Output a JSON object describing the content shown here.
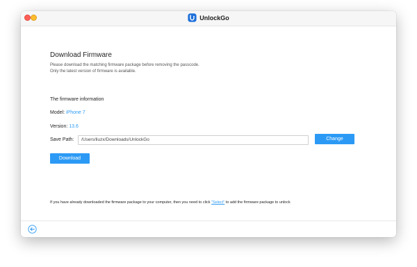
{
  "window": {
    "app_title": "UnlockGo"
  },
  "main": {
    "heading": "Download Firmware",
    "description_line1": "Please download the matching firmware package before removing the passcode.",
    "description_line2": "Only the latest version of firmware is available.",
    "section_title": "The firmware information",
    "model_label": "Model:",
    "model_value": "iPhone 7",
    "version_label": "Version:",
    "version_value": "13.6",
    "save_path_label": "Save Path:",
    "save_path_value": "/Users/liuzx/Downloads/UnlockGo",
    "change_button": "Change",
    "download_button": "Download",
    "footnote_prefix": "If you have already downloaded the firmware package to your computer, then you need to click ",
    "footnote_link": "\"Select\"",
    "footnote_suffix": " to add the firmware package to unlock"
  },
  "colors": {
    "accent": "#2c9af5",
    "close_light": "#fd5f57",
    "minimize_light": "#febc2e"
  },
  "icons": {
    "app_logo": "unlockgo-logo-icon",
    "back": "back-arrow-circle-icon"
  }
}
